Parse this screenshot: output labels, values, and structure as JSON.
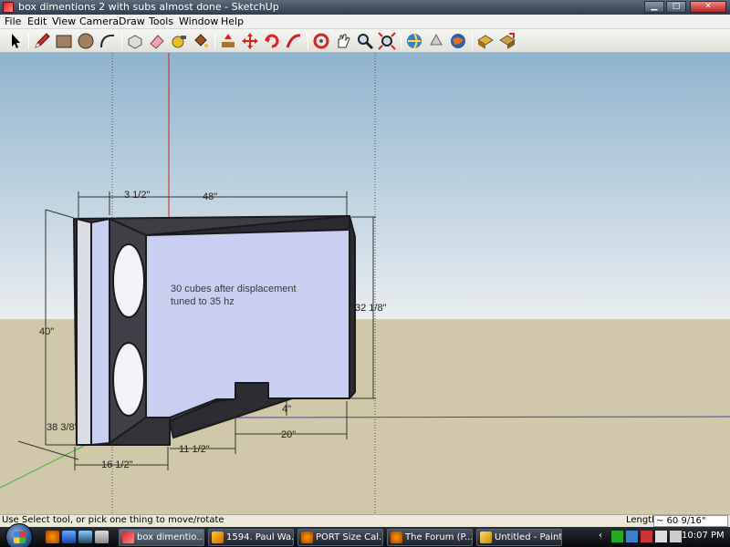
{
  "window": {
    "title": "box dimentions 2 with subs almost done - SketchUp",
    "controls": [
      "minimize-button",
      "maximize-button",
      "close-button"
    ]
  },
  "menu": {
    "items": [
      "File",
      "Edit",
      "View",
      "Camera",
      "Draw",
      "Tools",
      "Window",
      "Help"
    ]
  },
  "toolbar": {
    "tools": [
      {
        "name": "select-tool-icon"
      },
      {
        "name": "pencil-tool-icon"
      },
      {
        "name": "rectangle-tool-icon"
      },
      {
        "name": "circle-tool-icon"
      },
      {
        "name": "arc-tool-icon"
      },
      {
        "name": "make-component-icon"
      },
      {
        "name": "eraser-tool-icon"
      },
      {
        "name": "tape-measure-icon"
      },
      {
        "name": "paint-bucket-icon"
      },
      {
        "name": "push-pull-icon"
      },
      {
        "name": "move-tool-icon"
      },
      {
        "name": "rotate-tool-icon"
      },
      {
        "name": "follow-me-icon"
      },
      {
        "name": "orbit-tool-icon"
      },
      {
        "name": "pan-tool-icon"
      },
      {
        "name": "zoom-tool-icon"
      },
      {
        "name": "zoom-extents-icon"
      },
      {
        "name": "3d-warehouse-icon"
      },
      {
        "name": "share-model-icon"
      },
      {
        "name": "google-earth-icon"
      },
      {
        "name": "get-components-icon"
      },
      {
        "name": "share-component-icon"
      }
    ]
  },
  "model": {
    "note_line1": "30 cubes after displacement",
    "note_line2": "tuned to 35 hz",
    "dimensions": {
      "d1": "3 1/2\"",
      "d2": "48\"",
      "d3": "40\"",
      "d4": "32 1/8\"",
      "d5": "38 3/8\"",
      "d6": "16 1/2\"",
      "d7": "11 1/2\"",
      "d8": "20\"",
      "d9": "4\""
    },
    "colors": {
      "sky_top": "#8fb4cf",
      "sky_bottom": "#e9eef1",
      "ground": "#d1c8a9",
      "face": "#c9cff0",
      "edge": "#3d3d44"
    }
  },
  "status": {
    "text": "Use Select tool, or pick one thing to move/rotate",
    "length_label": "Length",
    "length_value": "~ 60 9/16\""
  },
  "taskbar": {
    "tasks": [
      {
        "label": "box dimentio...",
        "active": true
      },
      {
        "label": "1594. Paul Wa...",
        "active": false
      },
      {
        "label": "PORT Size Cal...",
        "active": false
      },
      {
        "label": "The Forum (P...",
        "active": false
      },
      {
        "label": "Untitled - Paint",
        "active": false
      }
    ],
    "clock": "10:07 PM"
  }
}
